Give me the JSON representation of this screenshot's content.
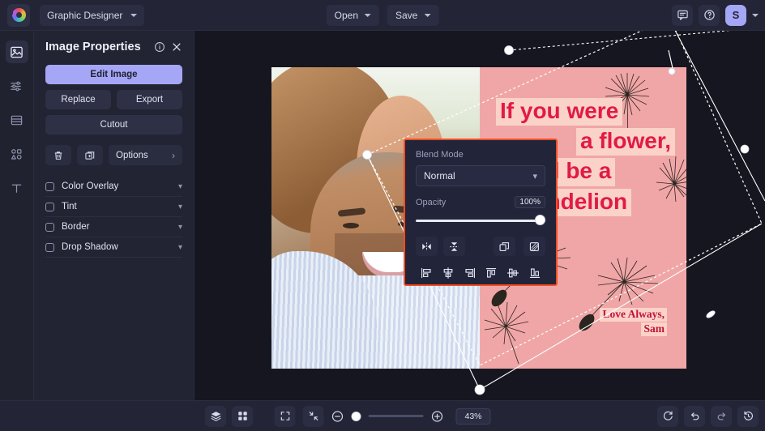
{
  "topbar": {
    "logo_icon": "color-wheel-logo",
    "document_name": "Graphic Designer",
    "open_label": "Open",
    "save_label": "Save",
    "comment_icon": "comment-icon",
    "help_icon": "help-circle-icon",
    "avatar_initial": "S"
  },
  "rail": {
    "items": [
      {
        "icon": "image-icon",
        "name": "images"
      },
      {
        "icon": "sliders-icon",
        "name": "adjustments"
      },
      {
        "icon": "layout-icon",
        "name": "layouts"
      },
      {
        "icon": "shapes-icon",
        "name": "elements"
      },
      {
        "icon": "text-icon",
        "name": "text"
      }
    ]
  },
  "panel": {
    "title": "Image Properties",
    "info_icon": "info-circle-icon",
    "close_icon": "close-x-icon",
    "edit_image_label": "Edit Image",
    "replace_label": "Replace",
    "export_label": "Export",
    "cutout_label": "Cutout",
    "delete_icon": "trash-icon",
    "duplicate_icon": "duplicate-icon",
    "options_label": "Options",
    "options_arrow": "›",
    "effects": [
      {
        "label": "Color Overlay",
        "checked": false
      },
      {
        "label": "Tint",
        "checked": false
      },
      {
        "label": "Border",
        "checked": false
      },
      {
        "label": "Drop Shadow",
        "checked": false
      }
    ]
  },
  "blend_panel": {
    "highlight_color": "#f04e23",
    "blend_mode_label": "Blend Mode",
    "blend_mode_value": "Normal",
    "opacity_label": "Opacity",
    "opacity_value": "100%",
    "opacity_percent": 100,
    "tools_row1": [
      {
        "icon": "flip-horizontal-icon",
        "name": "flip-horizontal"
      },
      {
        "icon": "flip-vertical-icon",
        "name": "flip-vertical"
      },
      {
        "icon": "bring-forward-icon",
        "name": "bring-forward"
      },
      {
        "icon": "send-backward-icon",
        "name": "send-backward"
      }
    ],
    "tools_row2": [
      {
        "icon": "align-left-icon",
        "name": "align-left"
      },
      {
        "icon": "align-center-horizontal-icon",
        "name": "align-center-horizontal"
      },
      {
        "icon": "align-right-icon",
        "name": "align-right"
      },
      {
        "icon": "align-top-icon",
        "name": "align-top"
      },
      {
        "icon": "align-middle-vertical-icon",
        "name": "align-middle-vertical"
      },
      {
        "icon": "align-bottom-icon",
        "name": "align-bottom"
      }
    ]
  },
  "canvas": {
    "card_background": "#f0a6a6",
    "highlight_background": "#fbd2c8",
    "headline_color": "#e11b43",
    "signature_color": "#c2123c",
    "headline_lines": [
      "If you were",
      "a flower,",
      "you'd be a",
      "damndelion"
    ],
    "signature_lines": [
      "Love Always,",
      "Sam"
    ]
  },
  "bottombar": {
    "layers_icon": "layers-icon",
    "grid_icon": "grid-icon",
    "fit_icon": "expand-frame-icon",
    "shrink_icon": "collapse-arrows-icon",
    "zoom_out_icon": "minus-circle-icon",
    "zoom_in_icon": "plus-circle-icon",
    "zoom_value": "43%",
    "zoom_percent": 43,
    "reset_icon": "refresh-icon",
    "undo_icon": "undo-arrow-icon",
    "redo_icon": "redo-arrow-icon",
    "history_icon": "history-clock-icon"
  }
}
